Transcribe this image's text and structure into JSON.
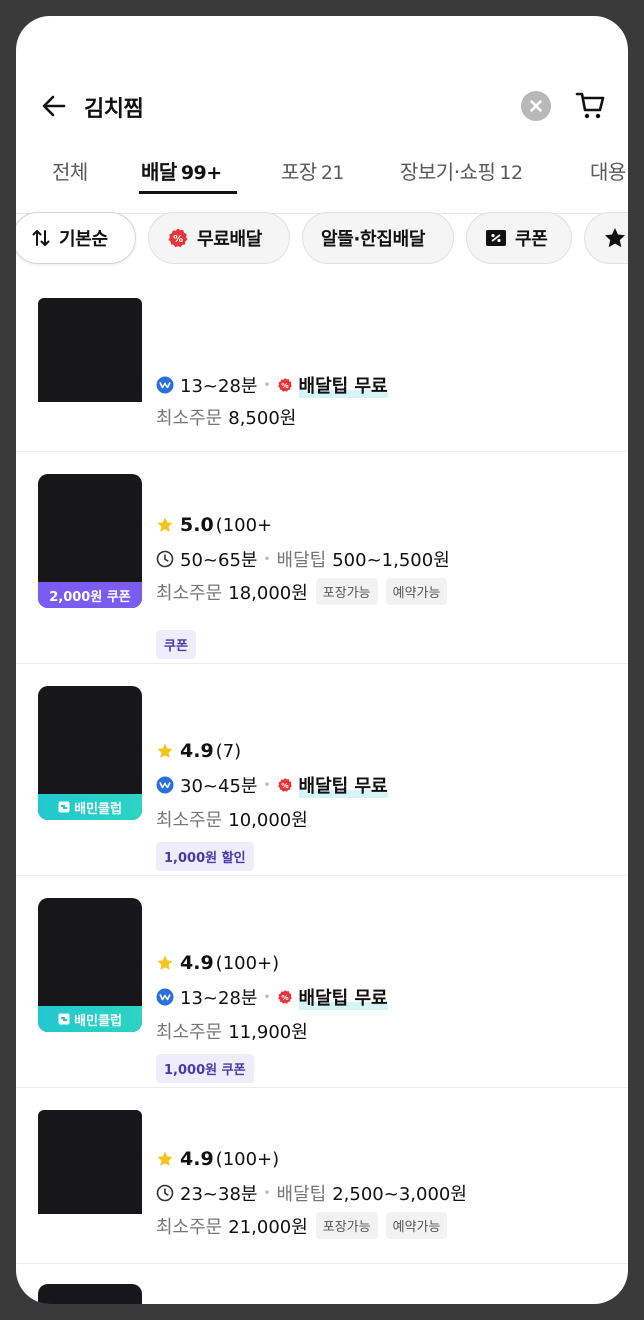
{
  "header": {
    "title": "김치찜"
  },
  "tabs": [
    {
      "label": "전체",
      "count": ""
    },
    {
      "label": "배달",
      "count": "99+"
    },
    {
      "label": "포장",
      "count": "21"
    },
    {
      "label": "장보기·쇼핑",
      "count": "12"
    },
    {
      "label": "대용",
      "count": ""
    }
  ],
  "filters": [
    {
      "label": "기본순"
    },
    {
      "label": "무료배달"
    },
    {
      "label": "알뜰·한집배달"
    },
    {
      "label": "쿠폰"
    }
  ],
  "colors": {
    "accent_purple": "#7a5cf0",
    "club_teal": "#23c7cf",
    "free_red": "#e8343c",
    "star": "#f5c518"
  },
  "stores": [
    {
      "rating": "",
      "rating_count": "",
      "time": "13~28분",
      "delivery_label": "배달팁 무료",
      "delivery_fee": "",
      "min_order_label": "최소주문",
      "min_order": "8,500원",
      "tags": [],
      "thumb_badge": "",
      "promo": ""
    },
    {
      "rating": "5.0",
      "rating_count": "(100+",
      "time": "50~65분",
      "delivery_label": "배달팁",
      "delivery_fee": "500~1,500원",
      "min_order_label": "최소주문",
      "min_order": "18,000원",
      "tags": [
        "포장가능",
        "예약가능"
      ],
      "thumb_badge": "2,000원 쿠폰",
      "promo": "쿠폰"
    },
    {
      "rating": "4.9",
      "rating_count": "(7)",
      "time": "30~45분",
      "delivery_label": "배달팁 무료",
      "delivery_fee": "",
      "min_order_label": "최소주문",
      "min_order": "10,000원",
      "tags": [],
      "thumb_badge": "배민클럽",
      "promo": "1,000원 할인"
    },
    {
      "rating": "4.9",
      "rating_count": "(100+)",
      "time": "13~28분",
      "delivery_label": "배달팁 무료",
      "delivery_fee": "",
      "min_order_label": "최소주문",
      "min_order": "11,900원",
      "tags": [],
      "thumb_badge": "배민클럽",
      "promo": "1,000원 쿠폰"
    },
    {
      "rating": "4.9",
      "rating_count": "(100+)",
      "time": "23~38분",
      "delivery_label": "배달팁",
      "delivery_fee": "2,500~3,000원",
      "min_order_label": "최소주문",
      "min_order": "21,000원",
      "tags": [
        "포장가능",
        "예약가능"
      ],
      "thumb_badge": "",
      "promo": ""
    }
  ]
}
